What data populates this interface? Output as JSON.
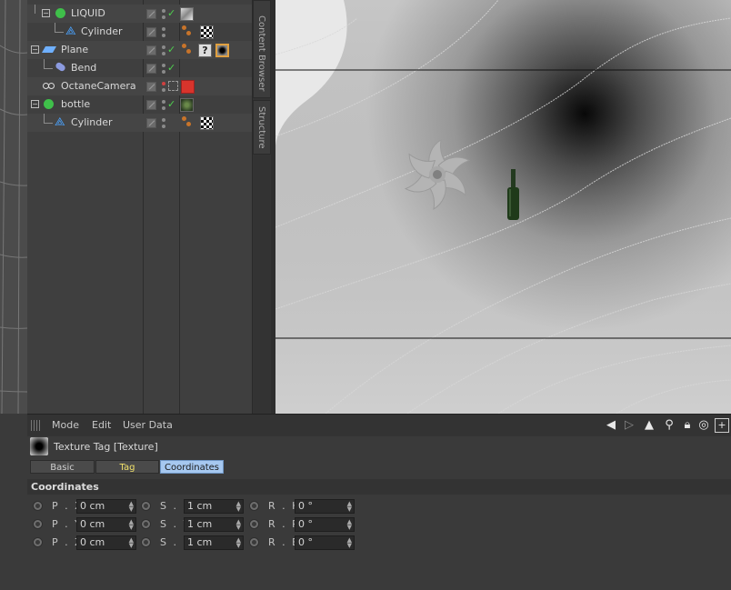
{
  "object_manager": {
    "objects": [
      {
        "name": "LIQUID",
        "icon": "null-object-icon"
      },
      {
        "name": "Cylinder",
        "icon": "cylinder-icon"
      },
      {
        "name": "Plane",
        "icon": "plane-icon"
      },
      {
        "name": "Bend",
        "icon": "bend-deformer-icon"
      },
      {
        "name": "OctaneCamera",
        "icon": "camera-icon"
      },
      {
        "name": "bottle",
        "icon": "null-object-icon"
      },
      {
        "name": "Cylinder",
        "icon": "cylinder-icon"
      }
    ]
  },
  "side_tabs": {
    "content_browser": "Content Browser",
    "structure": "Structure"
  },
  "attribute_manager": {
    "menu": {
      "mode": "Mode",
      "edit": "Edit",
      "user_data": "User Data"
    },
    "tag_title": "Texture Tag [Texture]",
    "tabs": {
      "basic": "Basic",
      "tag": "Tag",
      "coordinates": "Coordinates"
    },
    "active_tab": "Coordinates",
    "section_title": "Coordinates",
    "coords": {
      "px": {
        "label": "P . X",
        "value": "0 cm"
      },
      "py": {
        "label": "P . Y",
        "value": "0 cm"
      },
      "pz": {
        "label": "P . Z",
        "value": "0 cm"
      },
      "sx": {
        "label": "S . X",
        "value": "1 cm"
      },
      "sy": {
        "label": "S . Y",
        "value": "1 cm"
      },
      "sz": {
        "label": "S . Z",
        "value": "1 cm"
      },
      "rh": {
        "label": "R . H",
        "value": "0 °"
      },
      "rp": {
        "label": "R . P",
        "value": "0 °"
      },
      "rb": {
        "label": "R . B",
        "value": "0 °"
      }
    }
  },
  "colors": {
    "active_tab": "#a6c8f0",
    "tag_tab_text": "#f0e06a",
    "checkmark": "#4fd14f"
  }
}
